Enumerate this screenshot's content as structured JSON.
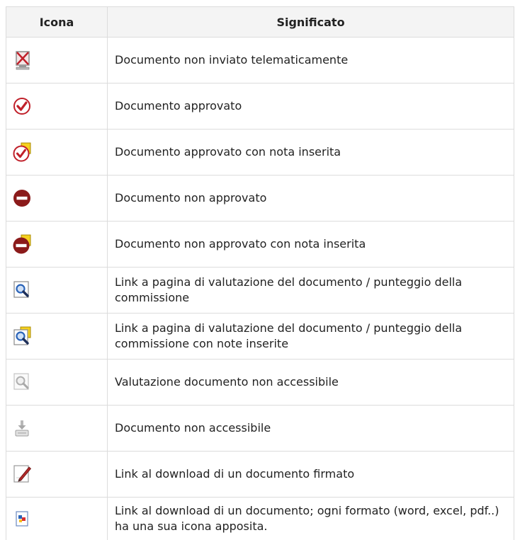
{
  "table": {
    "header_icon": "Icona",
    "header_meaning": "Significato",
    "rows": [
      {
        "icon": "not-sent-icon",
        "text": "Documento non inviato telematicamente"
      },
      {
        "icon": "approved-icon",
        "text": "Documento approvato"
      },
      {
        "icon": "approved-with-note-icon",
        "text": "Documento approvato con nota inserita"
      },
      {
        "icon": "not-approved-icon",
        "text": "Documento non approvato"
      },
      {
        "icon": "not-approved-with-note-icon",
        "text": "Documento non approvato con nota inserita"
      },
      {
        "icon": "evaluation-link-icon",
        "text": "Link a pagina di valutazione del documento / punteggio della commissione"
      },
      {
        "icon": "evaluation-link-with-notes-icon",
        "text": "Link a pagina di valutazione del documento / punteggio della commissione con note inserite"
      },
      {
        "icon": "evaluation-disabled-icon",
        "text": "Valutazione documento non accessibile"
      },
      {
        "icon": "download-disabled-icon",
        "text": "Documento non accessibile"
      },
      {
        "icon": "signed-document-download-icon",
        "text": "Link al download di un documento firmato"
      },
      {
        "icon": "document-download-icon",
        "text": "Link al download di un documento; ogni formato (word, excel, pdf..) ha una sua icona apposita."
      }
    ]
  },
  "colors": {
    "check_red": "#c0202a",
    "stop_red": "#8b1a1a",
    "note_yellow": "#f5d020",
    "magnifier_blue": "#2a63b8"
  }
}
